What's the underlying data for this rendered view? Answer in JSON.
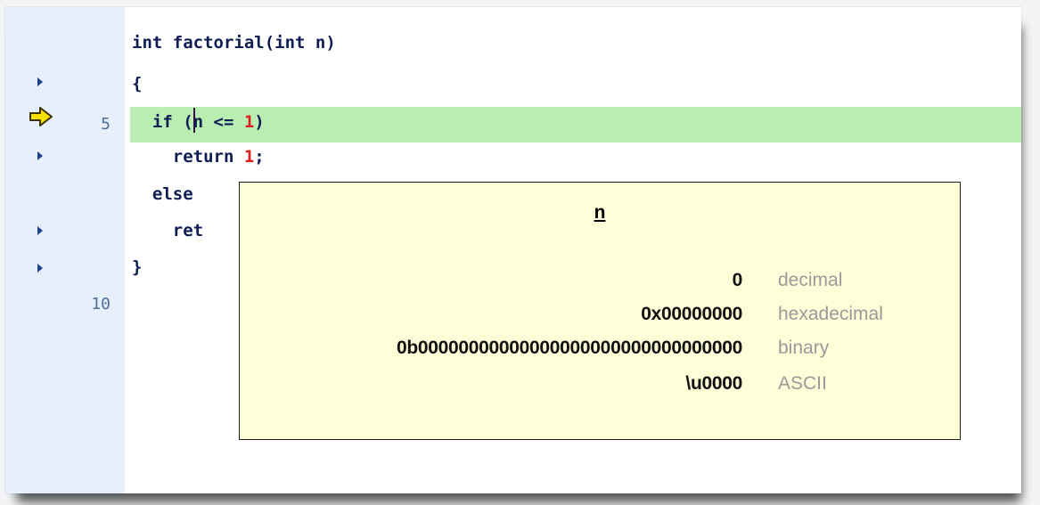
{
  "editor": {
    "code_lines": {
      "l1": "int factorial(int n)",
      "l2": "{",
      "l3_a": "  if (",
      "l3_b": "n <= ",
      "l3_num": "1",
      "l3_c": ")",
      "l4_a": "    return ",
      "l4_num": "1",
      "l4_c": ";",
      "l5": "  else",
      "l6": "    ret",
      "l7": "}"
    },
    "line_numbers": {
      "current": "5",
      "ten": "10"
    },
    "colors": {
      "gutter": "#e7effb",
      "current_line": "#b8eeb2",
      "keyword_text": "#0e1d53",
      "number_literal": "#e0201a",
      "execution_arrow": "#f5e000"
    }
  },
  "tooltip": {
    "title": "n",
    "rows": [
      {
        "value": "0",
        "format": "decimal"
      },
      {
        "value": "0x00000000",
        "format": "hexadecimal"
      },
      {
        "value": "0b00000000000000000000000000000000",
        "format": "binary"
      },
      {
        "value": "\\u0000",
        "format": "ASCII"
      }
    ],
    "colors": {
      "background": "#fefed8",
      "format_label": "#9a9a9a"
    }
  }
}
